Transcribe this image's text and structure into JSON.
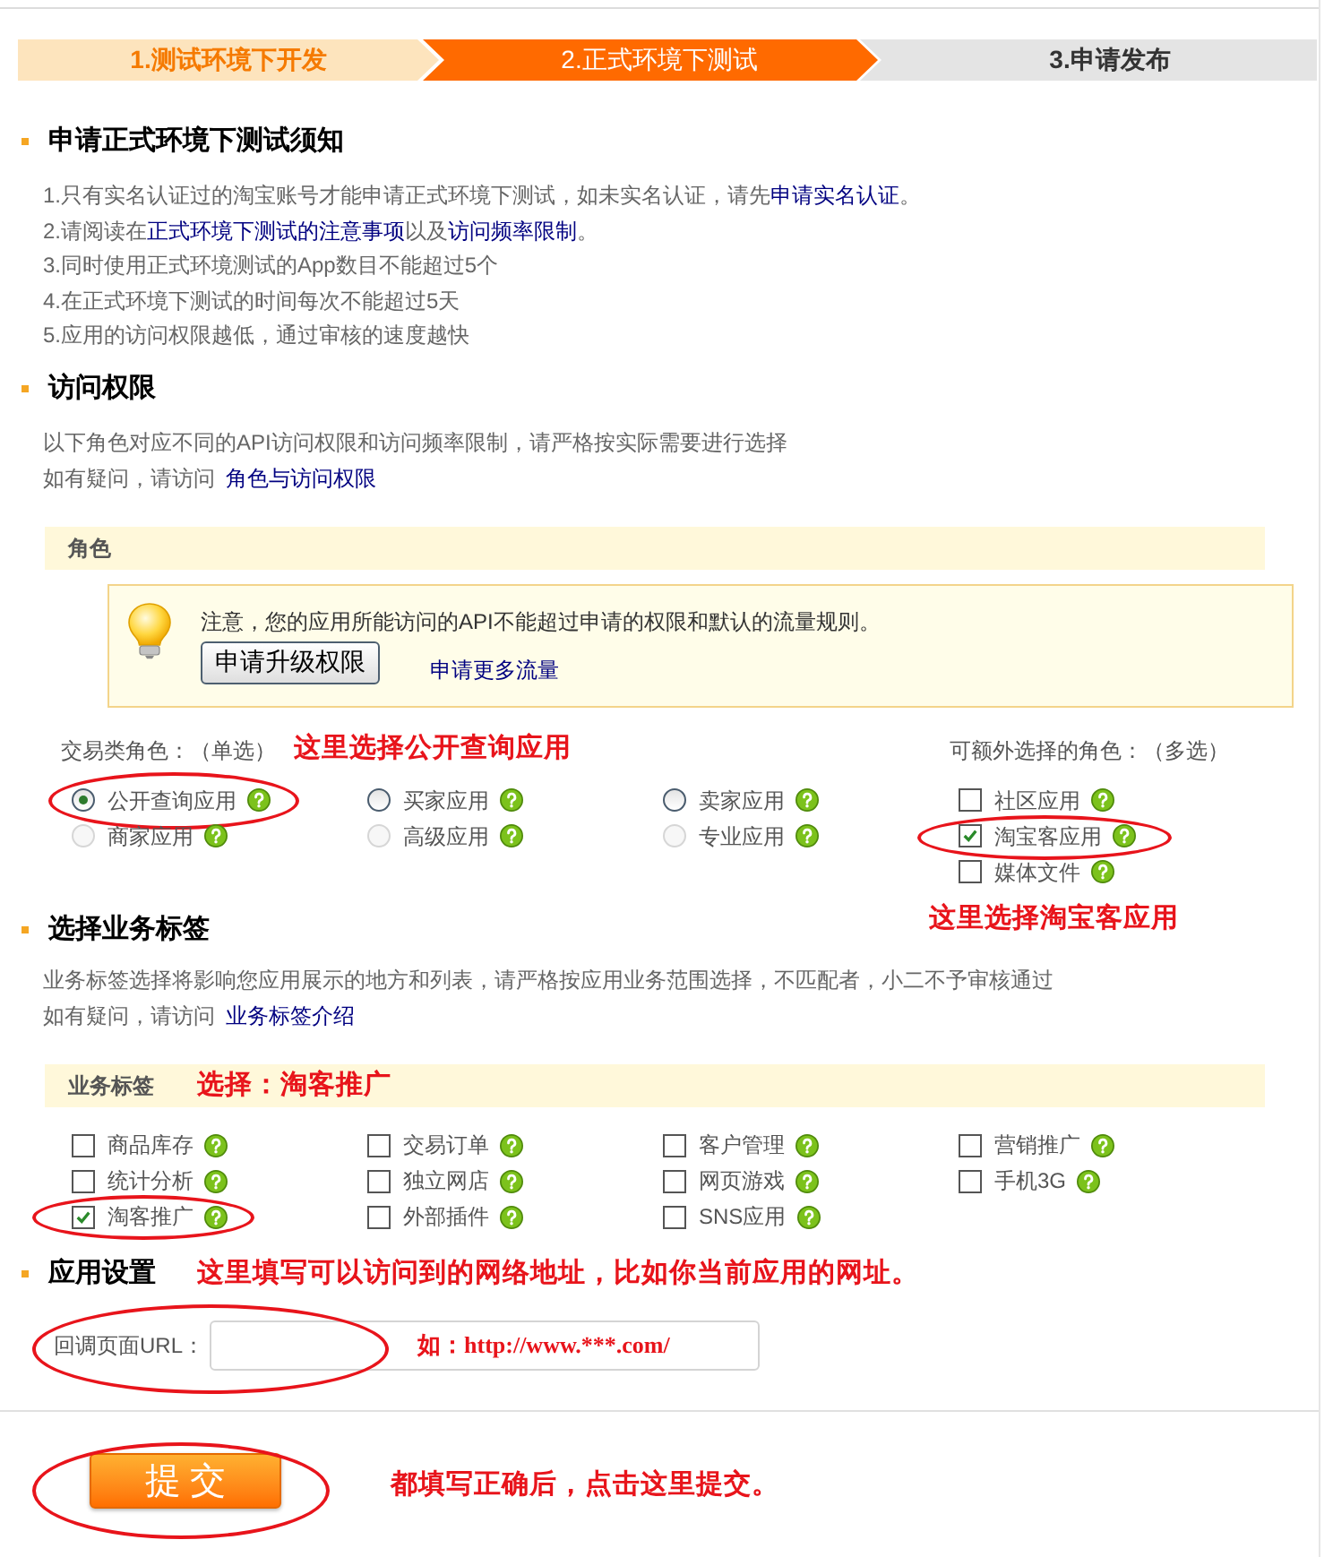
{
  "steps": [
    {
      "label": "1.测试环境下开发",
      "selected": false
    },
    {
      "label": "2.正式环境下测试",
      "selected": true
    },
    {
      "label": "3.申请发布",
      "selected": false
    }
  ],
  "notice": {
    "title": "申请正式环境下测试须知",
    "items": [
      {
        "segments": [
          {
            "kind": "text",
            "text": "1.只有实名认证过的淘宝账号才能申请正式环境下测试，如未实名认证，请先"
          },
          {
            "kind": "link",
            "text": "申请实名认证"
          },
          {
            "kind": "text",
            "text": "。"
          }
        ]
      },
      {
        "segments": [
          {
            "kind": "text",
            "text": "2.请阅读在"
          },
          {
            "kind": "link",
            "text": "正式环境下测试的注意事项"
          },
          {
            "kind": "text",
            "text": "以及"
          },
          {
            "kind": "link",
            "text": "访问频率限制"
          },
          {
            "kind": "text",
            "text": "。"
          }
        ]
      },
      {
        "segments": [
          {
            "kind": "text",
            "text": "3.同时使用正式环境测试的App数目不能超过5个"
          }
        ]
      },
      {
        "segments": [
          {
            "kind": "text",
            "text": "4.在正式环境下测试的时间每次不能超过5天"
          }
        ]
      },
      {
        "segments": [
          {
            "kind": "text",
            "text": "5.应用的访问权限越低，通过审核的速度越快"
          }
        ]
      }
    ]
  },
  "access": {
    "title": "访问权限",
    "description": "以下角色对应不同的API访问权限和访问频率限制，请严格按实际需要进行选择",
    "help_prefix": "如有疑问，请访问",
    "help_link": "角色与访问权限"
  },
  "role_panel": {
    "title": "角色",
    "notice": {
      "text": "注意，您的应用所能访问的API不能超过申请的权限和默认的流量规则。",
      "button": "申请升级权限",
      "link": "申请更多流量"
    },
    "single_label": "交易类角色：（单选）",
    "single_annotation": "这里选择公开查询应用",
    "multi_label": "可额外选择的角色：（多选）",
    "single_roles": [
      {
        "label": "公开查询应用",
        "selected": true,
        "disabled": false,
        "circled": true
      },
      {
        "label": "买家应用",
        "selected": false,
        "disabled": false,
        "circled": false
      },
      {
        "label": "卖家应用",
        "selected": false,
        "disabled": false,
        "circled": false
      },
      {
        "label": "商家应用",
        "selected": false,
        "disabled": true,
        "circled": false
      },
      {
        "label": "高级应用",
        "selected": false,
        "disabled": true,
        "circled": false
      },
      {
        "label": "专业应用",
        "selected": false,
        "disabled": true,
        "circled": false
      }
    ],
    "extra_roles": [
      {
        "label": "社区应用",
        "checked": false,
        "circled": false
      },
      {
        "label": "淘宝客应用",
        "checked": true,
        "circled": true
      },
      {
        "label": "媒体文件",
        "checked": false,
        "circled": false
      }
    ],
    "extra_annotation": "这里选择淘宝客应用"
  },
  "tags": {
    "title": "选择业务标签",
    "description": "业务标签选择将影响您应用展示的地方和列表，请严格按应用业务范围选择，不匹配者，小二不予审核通过",
    "help_prefix": "如有疑问，请访问",
    "help_link": "业务标签介绍",
    "bar_title": "业务标签",
    "bar_annotation": "选择：淘客推广",
    "items": [
      {
        "label": "商品库存",
        "checked": false,
        "circled": false
      },
      {
        "label": "交易订单",
        "checked": false,
        "circled": false
      },
      {
        "label": "客户管理",
        "checked": false,
        "circled": false
      },
      {
        "label": "营销推广",
        "checked": false,
        "circled": false
      },
      {
        "label": "统计分析",
        "checked": false,
        "circled": false
      },
      {
        "label": "独立网店",
        "checked": false,
        "circled": false
      },
      {
        "label": "网页游戏",
        "checked": false,
        "circled": false
      },
      {
        "label": "手机3G",
        "checked": false,
        "circled": false
      },
      {
        "label": "淘客推广",
        "checked": true,
        "circled": true
      },
      {
        "label": "外部插件",
        "checked": false,
        "circled": false
      },
      {
        "label": "SNS应用",
        "checked": false,
        "circled": false
      }
    ]
  },
  "settings": {
    "title": "应用设置",
    "annotation": "这里填写可以访问到的网络地址，比如你当前应用的网址。",
    "url_label": "回调页面URL：",
    "url_circled": true,
    "url_annotation": "如：http://www.***.com/"
  },
  "submit": {
    "label": "提 交",
    "circled": true,
    "annotation": "都填写正确后，点击这里提交。"
  }
}
